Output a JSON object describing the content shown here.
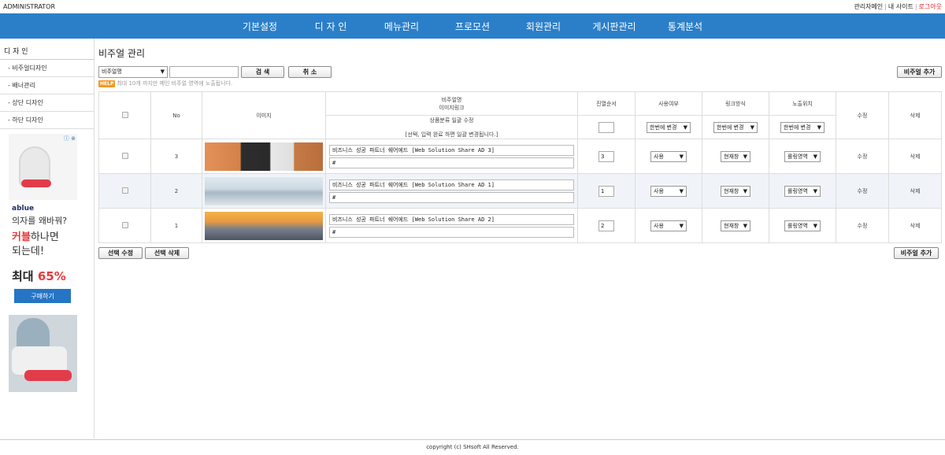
{
  "topbar": {
    "brand": "ADMINISTRATOR",
    "links": [
      "관리자메인",
      "내 사이트",
      "로그아웃"
    ],
    "separator": "|"
  },
  "nav": {
    "items": [
      "기본설정",
      "디 자 인",
      "메뉴관리",
      "프로모션",
      "회원관리",
      "게시판관리",
      "통계분석"
    ]
  },
  "sidebar": {
    "title": "디 자 인",
    "items": [
      "- 비주얼디자인",
      "- 배너관리",
      "- 상단 디자인",
      "- 하단 디자인"
    ]
  },
  "ad": {
    "info_icon": "ⓘ ⊗",
    "brand": "ablue",
    "line1": "의자를 왜바꿔?",
    "line2_accent": "커블",
    "line2_rest": "하나면",
    "line3": "되는데!",
    "discount_prefix": "최대 ",
    "discount_value": "65%",
    "buy_label": "구매하기"
  },
  "page": {
    "title": "비주얼 관리"
  },
  "search": {
    "select_value": "비주얼명",
    "input_value": "",
    "search_label": "검 색",
    "cancel_label": "취 소",
    "add_label": "비주얼 추가"
  },
  "help": {
    "badge": "HELP",
    "text": "최대 10개 까지만 메인 비주얼 영역에 노출됩니다."
  },
  "table": {
    "headers": {
      "no": "No",
      "image": "이미지",
      "name_line1": "비주얼명",
      "name_line2": "이미지링크",
      "order": "진열순서",
      "use": "사용여부",
      "link_mode": "링크방식",
      "position": "노출위치",
      "edit": "수정",
      "delete": "삭제"
    },
    "bulk": {
      "title": "상품분류 일괄 수정",
      "note": "[선택, 입력 완료 하면 일괄 변경됩니다.]",
      "use_select": "한번에 변경",
      "link_select": "한번에 변경",
      "position_select": "한번에 변경"
    },
    "rows": [
      {
        "no": "3",
        "name": "비즈니스 성공 파트너 쉐어에드 [Web Solution Share AD 3]",
        "link": "#",
        "order": "3",
        "use": "사용",
        "link_mode": "현재창",
        "position": "롤링영역",
        "edit": "수정",
        "delete": "삭제"
      },
      {
        "no": "2",
        "name": "비즈니스 성공 파트너 쉐어에드 [Web Solution Share AD 1]",
        "link": "#",
        "order": "1",
        "use": "사용",
        "link_mode": "현재창",
        "position": "롤링영역",
        "edit": "수정",
        "delete": "삭제"
      },
      {
        "no": "1",
        "name": "비즈니스 성공 파트너  쉐어에드 [Web Solution Share AD 2]",
        "link": "#",
        "order": "2",
        "use": "사용",
        "link_mode": "현재창",
        "position": "롤링영역",
        "edit": "수정",
        "delete": "삭제"
      }
    ]
  },
  "bottom": {
    "edit_selected": "선택 수정",
    "delete_selected": "선택 삭제",
    "add_label": "비주얼 추가"
  },
  "footer": {
    "text": "copyright (c) SHsoft All Reserved."
  }
}
